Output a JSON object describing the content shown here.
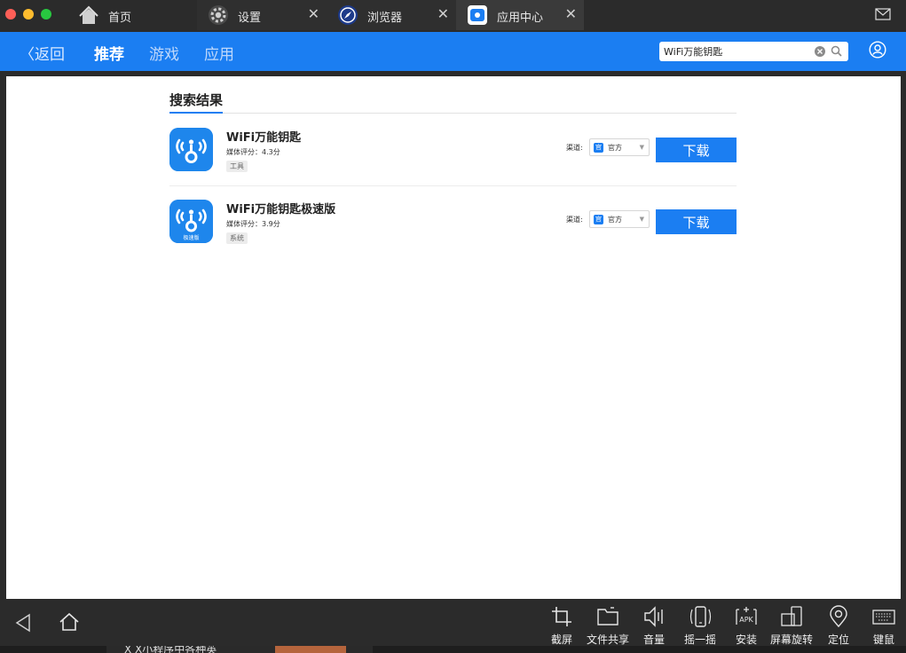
{
  "tabs": [
    {
      "label": "首页"
    },
    {
      "label": "设置",
      "close": "✕"
    },
    {
      "label": "浏览器",
      "close": "✕"
    },
    {
      "label": "应用中心",
      "close": "✕"
    }
  ],
  "header": {
    "back_label": "返回",
    "nav": [
      "推荐",
      "游戏",
      "应用"
    ],
    "active_nav": "推荐",
    "search_value": "WiFi万能钥匙"
  },
  "section_title": "搜索结果",
  "results": [
    {
      "name": "WiFi万能钥匙",
      "rating": "媒体评分：4.3分",
      "tag": "工具",
      "channel_label": "渠道:",
      "channel": "官方",
      "download": "下载"
    },
    {
      "name": "WiFi万能钥匙极速版",
      "rating": "媒体评分：3.9分",
      "tag": "系统",
      "channel_label": "渠道:",
      "channel": "官方",
      "download": "下载",
      "icon_badge": "极速版"
    }
  ],
  "dock_tools": [
    {
      "label": "截屏",
      "icon": "crop-icon"
    },
    {
      "label": "文件共享",
      "icon": "folder-icon"
    },
    {
      "label": "音量",
      "icon": "volume-icon"
    },
    {
      "label": "摇一摇",
      "icon": "shake-icon"
    },
    {
      "label": "安装",
      "icon": "apk-icon"
    },
    {
      "label": "屏幕旋转",
      "icon": "rotate-icon"
    },
    {
      "label": "定位",
      "icon": "location-icon"
    },
    {
      "label": "键鼠",
      "icon": "keyboard-icon"
    }
  ],
  "behind_text": "X X小程序中各种英",
  "colors": {
    "accent": "#1b7ef2",
    "chrome": "#2b2b2b"
  }
}
